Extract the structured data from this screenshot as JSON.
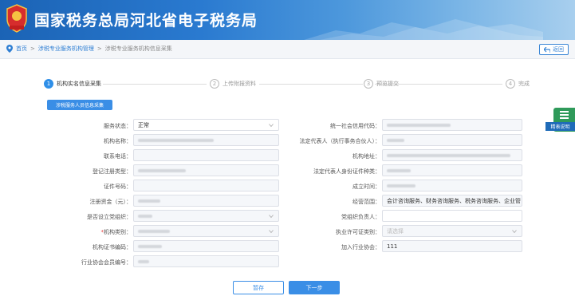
{
  "header": {
    "title": "国家税务总局河北省电子税务局",
    "emblem_icon": "tax-emblem-icon"
  },
  "breadcrumb": {
    "home": "首页",
    "sep": ">",
    "level1": "涉税专业服务机构管理",
    "level2": "涉税专业服务机构信息采集"
  },
  "back_button": "返回",
  "steps": [
    {
      "num": "1",
      "label": "机构实名信息采集"
    },
    {
      "num": "2",
      "label": "上传附报资料"
    },
    {
      "num": "3",
      "label": "预览提交"
    },
    {
      "num": "4",
      "label": "完成"
    }
  ],
  "sub_button": "涉税服务人员信息采集",
  "form": {
    "service_status": {
      "label": "服务状态：",
      "value": "正常"
    },
    "unified_code": {
      "label": "统一社会信用代码："
    },
    "org_name": {
      "label": "机构名称："
    },
    "legal_rep": {
      "label": "法定代表人（执行事务合伙人）："
    },
    "phone": {
      "label": "联系电话："
    },
    "address": {
      "label": "机构地址："
    },
    "reg_type": {
      "label": "登记注册类型："
    },
    "legal_id_type": {
      "label": "法定代表人身份证件种类："
    },
    "id_number": {
      "label": "证件号码："
    },
    "established": {
      "label": "成立时间："
    },
    "capital": {
      "label": "注册资金（元）："
    },
    "business_scope": {
      "label": "经营范围：",
      "value": "会计咨询服务、财务咨询服务、税务咨询服务、企业管"
    },
    "party_org": {
      "label": "是否设立党组织："
    },
    "party_leader": {
      "label": "党组织负责人："
    },
    "org_category": {
      "label": "机构类别：",
      "req": "*"
    },
    "license_type": {
      "label": "执业许可证类别：",
      "placeholder": "请选择"
    },
    "cert_code": {
      "label": "机构证书编码："
    },
    "join_assoc": {
      "label": "加入行业协会：",
      "value": "111"
    },
    "member_no": {
      "label": "行业协会会员编号："
    }
  },
  "buttons": {
    "save": "暂存",
    "next": "下一步"
  },
  "side_widget": {
    "label": "精表说明"
  },
  "colors": {
    "primary": "#3a8ee6",
    "header": "#1b63b5",
    "required": "#e63b3b"
  }
}
